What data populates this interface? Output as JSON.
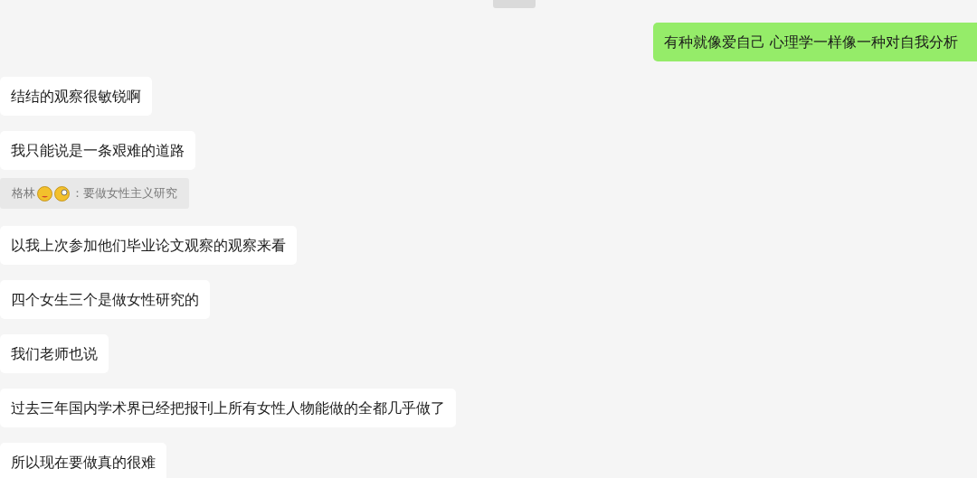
{
  "messages": [
    {
      "kind": "sent",
      "text": "有种就像爱自己 心理学一样像一种对自我分析"
    },
    {
      "kind": "received",
      "text": "结结的观察很敏锐啊"
    },
    {
      "kind": "received",
      "text": "我只能说是一条艰难的道路"
    },
    {
      "kind": "quote",
      "author": "格林",
      "text": "：要做女性主义研究"
    },
    {
      "kind": "received",
      "text": "以我上次参加他们毕业论文观察的观察来看"
    },
    {
      "kind": "received",
      "text": "四个女生三个是做女性研究的"
    },
    {
      "kind": "received",
      "text": "我们老师也说"
    },
    {
      "kind": "received",
      "text": "过去三年国内学术界已经把报刊上所有女性人物能做的全都几乎做了"
    },
    {
      "kind": "received",
      "text": "所以现在要做真的很难"
    }
  ]
}
